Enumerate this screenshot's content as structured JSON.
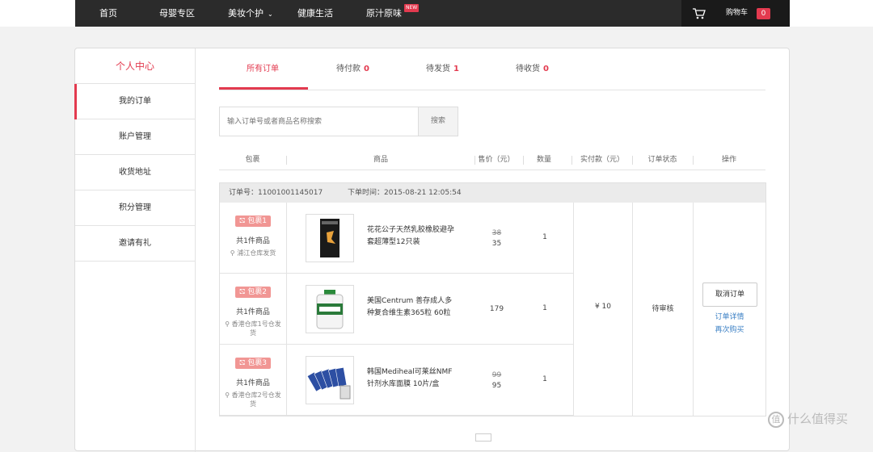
{
  "nav": {
    "items": [
      "首页",
      "母婴专区",
      "美妆个护",
      "健康生活",
      "原汁原味"
    ],
    "new_badge": "NEW",
    "cart_label": "购物车",
    "cart_count": "0"
  },
  "sidebar": {
    "title": "个人中心",
    "items": [
      "我的订单",
      "账户管理",
      "收货地址",
      "积分管理",
      "邀请有礼"
    ]
  },
  "tabs": [
    {
      "label": "所有订单",
      "count": ""
    },
    {
      "label": "待付款",
      "count": "0"
    },
    {
      "label": "待发货",
      "count": "1"
    },
    {
      "label": "待收货",
      "count": "0"
    }
  ],
  "search": {
    "placeholder": "输入订单号或者商品名称搜索",
    "button": "搜索"
  },
  "columns": [
    "包裹",
    "商品",
    "售价（元）",
    "数量",
    "实付款（元）",
    "订单状态",
    "操作"
  ],
  "order": {
    "number": "订单号：11001001145017",
    "time": "下单时间：2015-08-21 12:05:54",
    "paid": "¥ 10",
    "status": "待审核",
    "cancel": "取消订单",
    "detail": "订单详情",
    "rebuy": "再次购买",
    "packages": [
      {
        "badge": "包裹1",
        "count": "共1件商品",
        "location": "浦江仓库发货",
        "name": "花花公子天然乳胶橡胶避孕套超薄型12只装",
        "old_price": "38",
        "price": "35",
        "qty": "1"
      },
      {
        "badge": "包裹2",
        "count": "共1件商品",
        "location": "香港仓库1号仓发货",
        "name": "美国Centrum 善存成人多种复合维生素365粒 60粒",
        "old_price": "",
        "price": "179",
        "qty": "1"
      },
      {
        "badge": "包裹3",
        "count": "共1件商品",
        "location": "香港仓库2号仓发货",
        "name": "韩国Mediheal可莱丝NMF针剂水库面膜 10片/盒",
        "old_price": "99",
        "price": "95",
        "qty": "1"
      }
    ]
  },
  "watermark": "什么值得买",
  "colors": {
    "accent": "#e33a4f",
    "nav_bg": "#2b2b2b",
    "link": "#3a7fc4"
  }
}
